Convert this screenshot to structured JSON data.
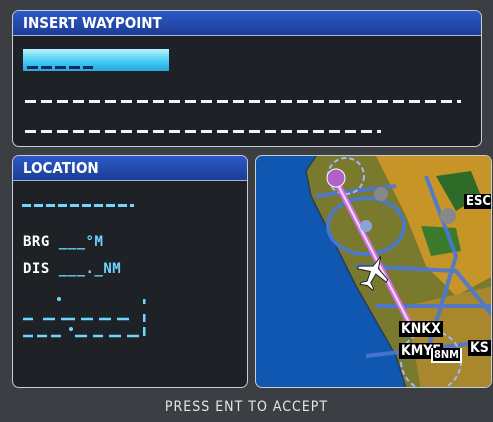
{
  "insert_panel": {
    "title": "INSERT WAYPOINT"
  },
  "location_panel": {
    "title": "LOCATION",
    "brg_label": "BRG",
    "brg_value": "___°M",
    "dis_label": "DIS",
    "dis_value": "___._NM"
  },
  "map": {
    "airports": [
      "KNKX",
      "KMYF",
      "KS"
    ],
    "partial_label": "ESC",
    "scale": "8NM"
  },
  "footer": {
    "prompt": "PRESS ENT TO ACCEPT"
  },
  "colors": {
    "title_blue": "#2b59c9",
    "cursor_cyan": "#3fc9f0",
    "field_cyan": "#6fd6ff",
    "panel_bg": "#1e2226",
    "route_magenta": "#d070e0"
  }
}
